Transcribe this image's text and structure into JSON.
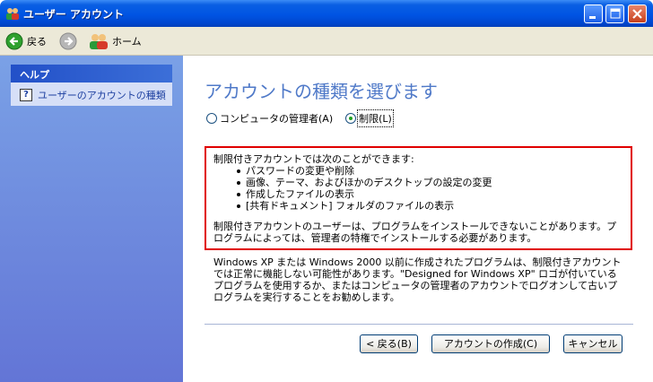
{
  "window": {
    "title": "ユーザー アカウント"
  },
  "toolbar": {
    "back_label": "戻る",
    "home_label": "ホーム"
  },
  "sidebar": {
    "help_title": "ヘルプ",
    "help_link": "ユーザーのアカウントの種類"
  },
  "main": {
    "heading": "アカウントの種類を選びます",
    "radios": [
      {
        "label": "コンピュータの管理者(A)",
        "selected": false
      },
      {
        "label": "制限(L)",
        "selected": true
      }
    ],
    "info": {
      "intro": "制限付きアカウントでは次のことができます:",
      "items": [
        "パスワードの変更や削除",
        "画像、テーマ、およびほかのデスクトップの設定の変更",
        "作成したファイルの表示",
        "[共有ドキュメント] フォルダのファイルの表示"
      ],
      "warning": "制限付きアカウントのユーザーは、プログラムをインストールできないことがあります。プログラムによっては、管理者の特権でインストールする必要があります。"
    },
    "note": "Windows XP または Windows 2000 以前に作成されたプログラムは、制限付きアカウントでは正常に機能しない可能性があります。\"Designed for Windows XP\" ロゴが付いているプログラムを使用するか、またはコンピュータの管理者のアカウントでログオンして古いプログラムを実行することをお勧めします。",
    "buttons": {
      "back": "< 戻る(B)",
      "create": "アカウントの作成(C)",
      "cancel": "キャンセル"
    }
  },
  "colors": {
    "titlebar": "#0054e3",
    "sidebar": "#6f8ee0",
    "heading": "#4f79c8",
    "highlight_border": "#e00000"
  }
}
